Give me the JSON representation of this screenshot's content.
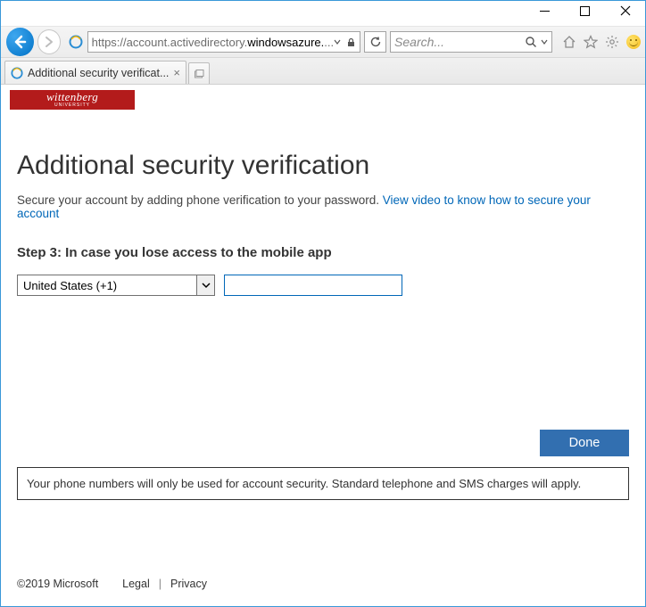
{
  "window": {
    "address_prefix": "https://account.activedirectory.",
    "address_bold": "windowsazure.",
    "address_suffix": "...",
    "search_placeholder": "Search...",
    "tab_title": "Additional security verificat..."
  },
  "brand": {
    "name": "wittenberg",
    "sub": "UNIVERSITY"
  },
  "content": {
    "heading": "Additional security verification",
    "lead_text": "Secure your account by adding phone verification to your password. ",
    "lead_link": "View video to know how to secure your account",
    "step_label": "Step 3: In case you lose access to the mobile app",
    "country_selected": "United States (+1)",
    "phone_value": "",
    "done_label": "Done",
    "notice": "Your phone numbers will only be used for account security. Standard telephone and SMS charges will apply."
  },
  "footer": {
    "copyright": "©2019 Microsoft",
    "legal": "Legal",
    "privacy": "Privacy"
  }
}
